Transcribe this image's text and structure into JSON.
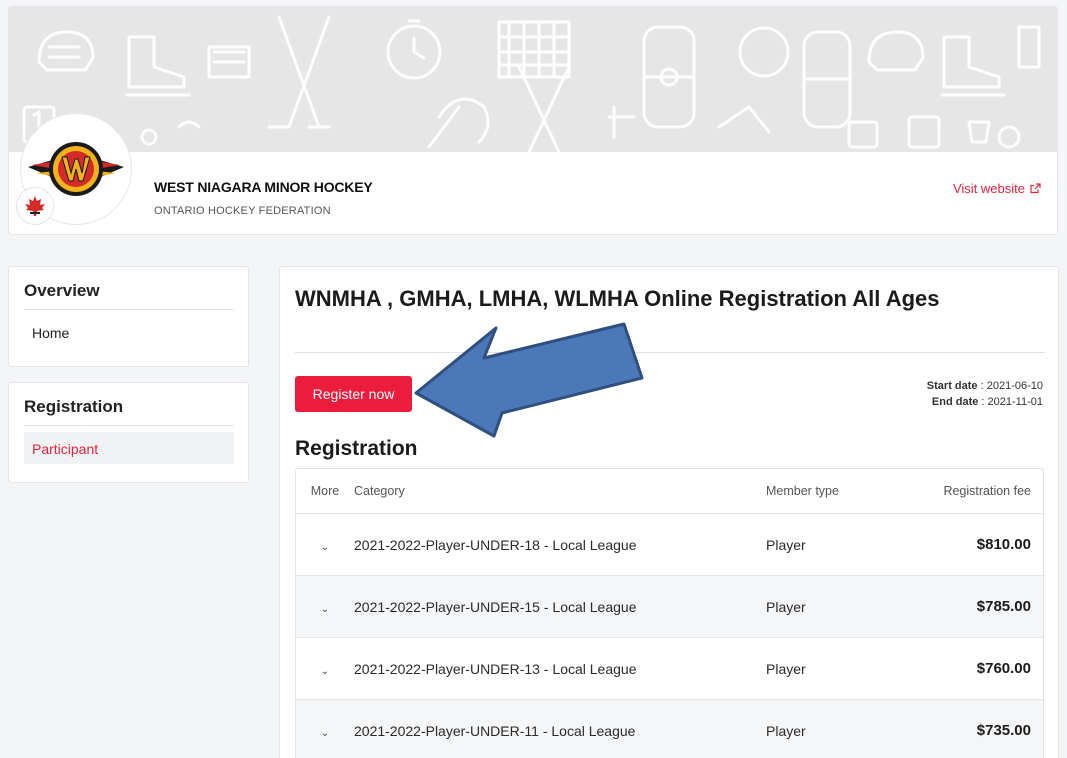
{
  "org": {
    "name": "WEST NIAGARA MINOR HOCKEY",
    "federation": "ONTARIO HOCKEY FEDERATION",
    "visit_label": "Visit website",
    "logo_letter": "W",
    "logo_arc_text": "WEST NIAGARA",
    "logo_bottom_text": "FLYING AVES"
  },
  "sidebar": {
    "overview": {
      "title": "Overview",
      "items": [
        {
          "label": "Home"
        }
      ]
    },
    "registration": {
      "title": "Registration",
      "items": [
        {
          "label": "Participant"
        }
      ]
    }
  },
  "main": {
    "title": "WNMHA , GMHA, LMHA, WLMHA Online Registration All Ages",
    "register_label": "Register now",
    "start_label": "Start date",
    "start_value": "2021-06-10",
    "end_label": "End date",
    "end_value": "2021-11-01",
    "section_heading": "Registration"
  },
  "table": {
    "headers": {
      "more": "More",
      "category": "Category",
      "member_type": "Member type",
      "fee": "Registration fee"
    },
    "rows": [
      {
        "category": "2021-2022-Player-UNDER-18 - Local League",
        "member_type": "Player",
        "fee": "$810.00"
      },
      {
        "category": "2021-2022-Player-UNDER-15 - Local League",
        "member_type": "Player",
        "fee": "$785.00"
      },
      {
        "category": "2021-2022-Player-UNDER-13 - Local League",
        "member_type": "Player",
        "fee": "$760.00"
      },
      {
        "category": "2021-2022-Player-UNDER-11 - Local League",
        "member_type": "Player",
        "fee": "$735.00"
      }
    ]
  },
  "colors": {
    "accent": "#ec1c3d",
    "arrow_fill": "#4a78b8",
    "arrow_stroke": "#2f4f7f"
  },
  "icons": {
    "external": "external-link-icon",
    "chevron": "chevron-down-icon"
  }
}
